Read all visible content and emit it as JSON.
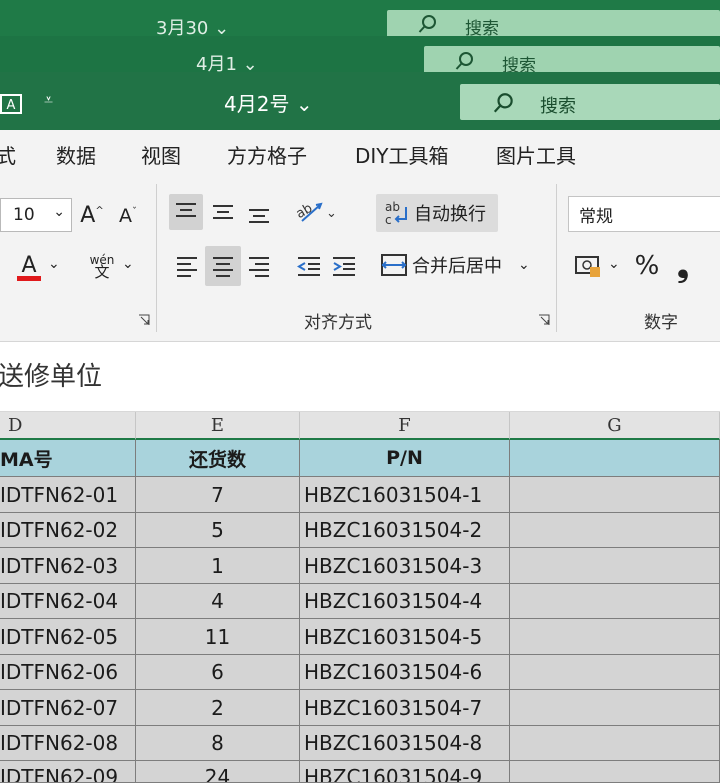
{
  "windows": [
    {
      "title": "3月30",
      "search_label": "搜索"
    },
    {
      "title": "4月1",
      "search_label": "搜索"
    },
    {
      "title": "4月2号",
      "search_label": "搜索"
    }
  ],
  "ribbon": {
    "tabs": [
      "式",
      "数据",
      "视图",
      "方方格子",
      "DIY工具箱",
      "图片工具"
    ],
    "font_size_value": "10",
    "wrap_text_label": "自动换行",
    "merge_center_label": "合并后居中",
    "number_format_value": "常规",
    "alignment_group_label": "对齐方式",
    "number_group_label": "数字",
    "font_color": "#e0191b"
  },
  "formula_bar": {
    "content": "送修单位"
  },
  "sheet": {
    "column_letters": [
      "D",
      "E",
      "F",
      "G"
    ],
    "headers": [
      "MA号",
      "还货数",
      "P/N",
      ""
    ],
    "rows": [
      [
        "IDTFN62-01",
        "7",
        "HBZC16031504-1"
      ],
      [
        "IDTFN62-02",
        "5",
        "HBZC16031504-2"
      ],
      [
        "IDTFN62-03",
        "1",
        "HBZC16031504-3"
      ],
      [
        "IDTFN62-04",
        "4",
        "HBZC16031504-4"
      ],
      [
        "IDTFN62-05",
        "11",
        "HBZC16031504-5"
      ],
      [
        "IDTFN62-06",
        "6",
        "HBZC16031504-6"
      ],
      [
        "IDTFN62-07",
        "2",
        "HBZC16031504-7"
      ],
      [
        "IDTFN62-08",
        "8",
        "HBZC16031504-8"
      ],
      [
        "IDTFN62-09",
        "24",
        "HBZC16031504-9"
      ]
    ],
    "header_fill": "#a9d3dc",
    "cell_fill": "#d4d4d4"
  }
}
